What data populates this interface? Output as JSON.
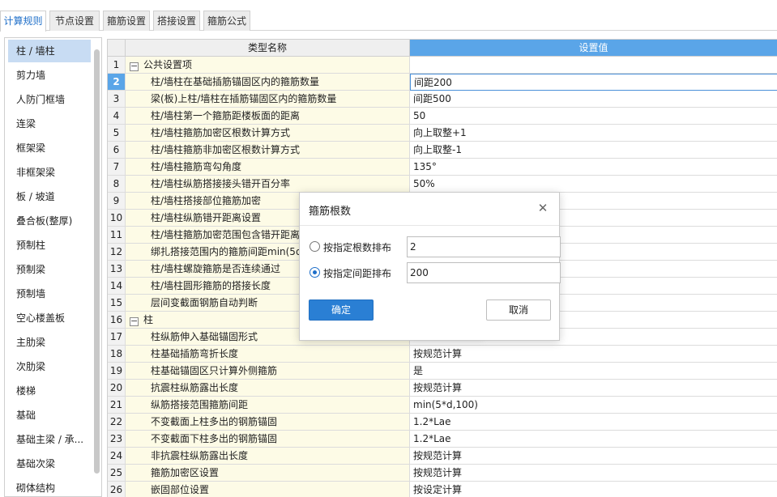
{
  "tabs": [
    {
      "label": "计算规则",
      "active": true
    },
    {
      "label": "节点设置",
      "active": false
    },
    {
      "label": "箍筋设置",
      "active": false
    },
    {
      "label": "搭接设置",
      "active": false
    },
    {
      "label": "箍筋公式",
      "active": false
    }
  ],
  "sidebar": {
    "items": [
      {
        "label": "柱 / 墙柱",
        "active": true
      },
      {
        "label": "剪力墙"
      },
      {
        "label": "人防门框墙"
      },
      {
        "label": "连梁"
      },
      {
        "label": "框架梁"
      },
      {
        "label": "非框架梁"
      },
      {
        "label": "板 / 坡道"
      },
      {
        "label": "叠合板(整厚)"
      },
      {
        "label": "预制柱"
      },
      {
        "label": "预制梁"
      },
      {
        "label": "预制墙"
      },
      {
        "label": "空心楼盖板"
      },
      {
        "label": "主肋梁"
      },
      {
        "label": "次肋梁"
      },
      {
        "label": "楼梯"
      },
      {
        "label": "基础"
      },
      {
        "label": "基础主梁 / 承..."
      },
      {
        "label": "基础次梁"
      },
      {
        "label": "砌体结构"
      }
    ]
  },
  "grid": {
    "header_name": "类型名称",
    "header_value": "设置值",
    "rows": [
      {
        "num": "1",
        "name": "公共设置项",
        "value": "",
        "group": true,
        "expander": "−"
      },
      {
        "num": "2",
        "name": "柱/墙柱在基础插筋锚固区内的箍筋数量",
        "value": "间距200",
        "selected": true
      },
      {
        "num": "3",
        "name": "梁(板)上柱/墙柱在插筋锚固区内的箍筋数量",
        "value": "间距500"
      },
      {
        "num": "4",
        "name": "柱/墙柱第一个箍筋距楼板面的距离",
        "value": "50"
      },
      {
        "num": "5",
        "name": "柱/墙柱箍筋加密区根数计算方式",
        "value": "向上取整+1"
      },
      {
        "num": "6",
        "name": "柱/墙柱箍筋非加密区根数计算方式",
        "value": "向上取整-1"
      },
      {
        "num": "7",
        "name": "柱/墙柱箍筋弯勾角度",
        "value": "135°"
      },
      {
        "num": "8",
        "name": "柱/墙柱纵筋搭接接头错开百分率",
        "value": "50%"
      },
      {
        "num": "9",
        "name": "柱/墙柱搭接部位箍筋加密",
        "value": ""
      },
      {
        "num": "10",
        "name": "柱/墙柱纵筋错开距离设置",
        "value": ""
      },
      {
        "num": "11",
        "name": "柱/墙柱箍筋加密范围包含错开距离",
        "value": ""
      },
      {
        "num": "12",
        "name": "绑扎搭接范围内的箍筋间距min(5d",
        "value": ""
      },
      {
        "num": "13",
        "name": "柱/墙柱螺旋箍筋是否连续通过",
        "value": ""
      },
      {
        "num": "14",
        "name": "柱/墙柱圆形箍筋的搭接长度",
        "value": ""
      },
      {
        "num": "15",
        "name": "层间变截面钢筋自动判断",
        "value": ""
      },
      {
        "num": "16",
        "name": "柱",
        "value": "",
        "group": true,
        "expander": "−"
      },
      {
        "num": "17",
        "name": "柱纵筋伸入基础锚固形式",
        "value": ""
      },
      {
        "num": "18",
        "name": "柱基础插筋弯折长度",
        "value": "按规范计算"
      },
      {
        "num": "19",
        "name": "柱基础锚固区只计算外侧箍筋",
        "value": "是"
      },
      {
        "num": "20",
        "name": "抗震柱纵筋露出长度",
        "value": "按规范计算"
      },
      {
        "num": "21",
        "name": "纵筋搭接范围箍筋间距",
        "value": "min(5*d,100)"
      },
      {
        "num": "22",
        "name": "不变截面上柱多出的钢筋锚固",
        "value": "1.2*Lae"
      },
      {
        "num": "23",
        "name": "不变截面下柱多出的钢筋锚固",
        "value": "1.2*Lae"
      },
      {
        "num": "24",
        "name": "非抗震柱纵筋露出长度",
        "value": "按规范计算"
      },
      {
        "num": "25",
        "name": "箍筋加密区设置",
        "value": "按规范计算"
      },
      {
        "num": "26",
        "name": "嵌固部位设置",
        "value": "按设定计算"
      }
    ]
  },
  "dialog": {
    "title": "箍筋根数",
    "close_icon": "close-icon",
    "option_count_label": "按指定根数排布",
    "option_count_value": "2",
    "option_spacing_label": "按指定间距排布",
    "option_spacing_value": "200",
    "selected_option": "spacing",
    "ok_label": "确定",
    "cancel_label": "取消"
  }
}
